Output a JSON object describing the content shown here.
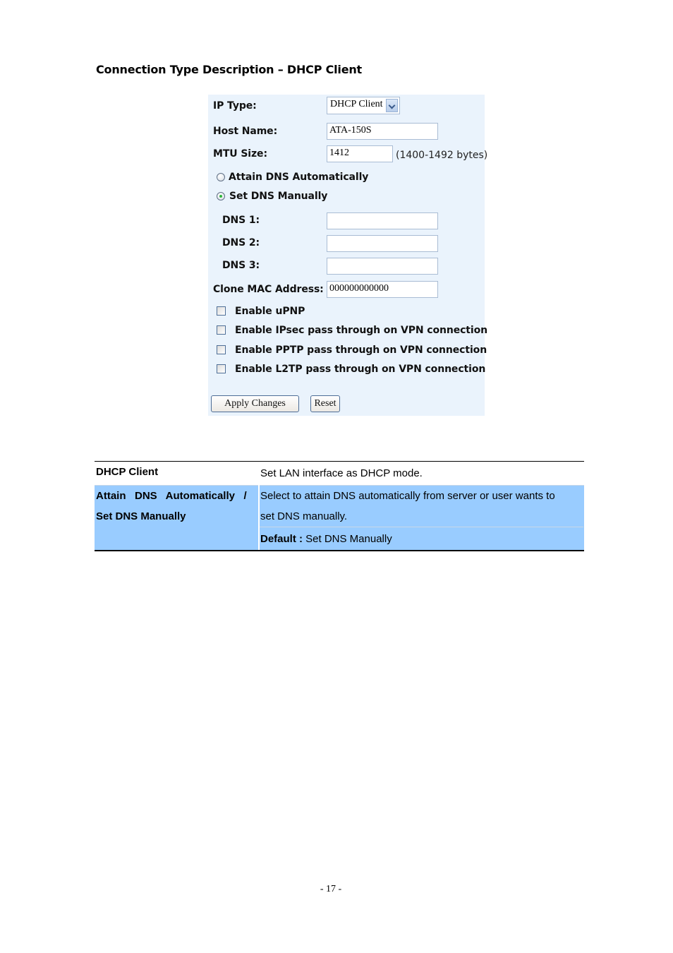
{
  "section_title": "Connection Type Description – DHCP Client",
  "form": {
    "ip_type": {
      "label": "IP Type:",
      "selected": "DHCP Client"
    },
    "host_name": {
      "label": "Host Name:",
      "value": "ATA-150S"
    },
    "mtu_size": {
      "label": "MTU Size:",
      "value": "1412",
      "hint": "(1400-1492 bytes)"
    },
    "dns_mode": {
      "options": [
        {
          "label": "Attain DNS Automatically",
          "checked": false
        },
        {
          "label": "Set DNS Manually",
          "checked": true
        }
      ]
    },
    "dns1": {
      "label": "DNS 1:",
      "value": ""
    },
    "dns2": {
      "label": "DNS 2:",
      "value": ""
    },
    "dns3": {
      "label": "DNS 3:",
      "value": ""
    },
    "clone_mac": {
      "label": "Clone MAC Address:",
      "value": "000000000000"
    },
    "checkboxes": [
      {
        "label": "Enable uPNP",
        "checked": false
      },
      {
        "label": "Enable IPsec pass through on VPN connection",
        "checked": false
      },
      {
        "label": "Enable PPTP pass through on VPN connection",
        "checked": false
      },
      {
        "label": "Enable L2TP pass through on VPN connection",
        "checked": false
      }
    ],
    "buttons": {
      "apply": "Apply Changes",
      "reset": "Reset"
    }
  },
  "description_table": {
    "rows": [
      {
        "term": "DHCP Client",
        "description": "Set LAN interface as DHCP mode."
      },
      {
        "term_line1": "Attain   DNS   Automatically   /",
        "term_line2": "Set DNS Manually",
        "description_line1": "Select to attain DNS automatically from server or user wants to",
        "description_line2": "set DNS manually.",
        "default_label": "Default :",
        "default_value": " Set DNS Manually"
      }
    ],
    "highlight_color": "#99ccff"
  },
  "page_number": "- 17 -"
}
